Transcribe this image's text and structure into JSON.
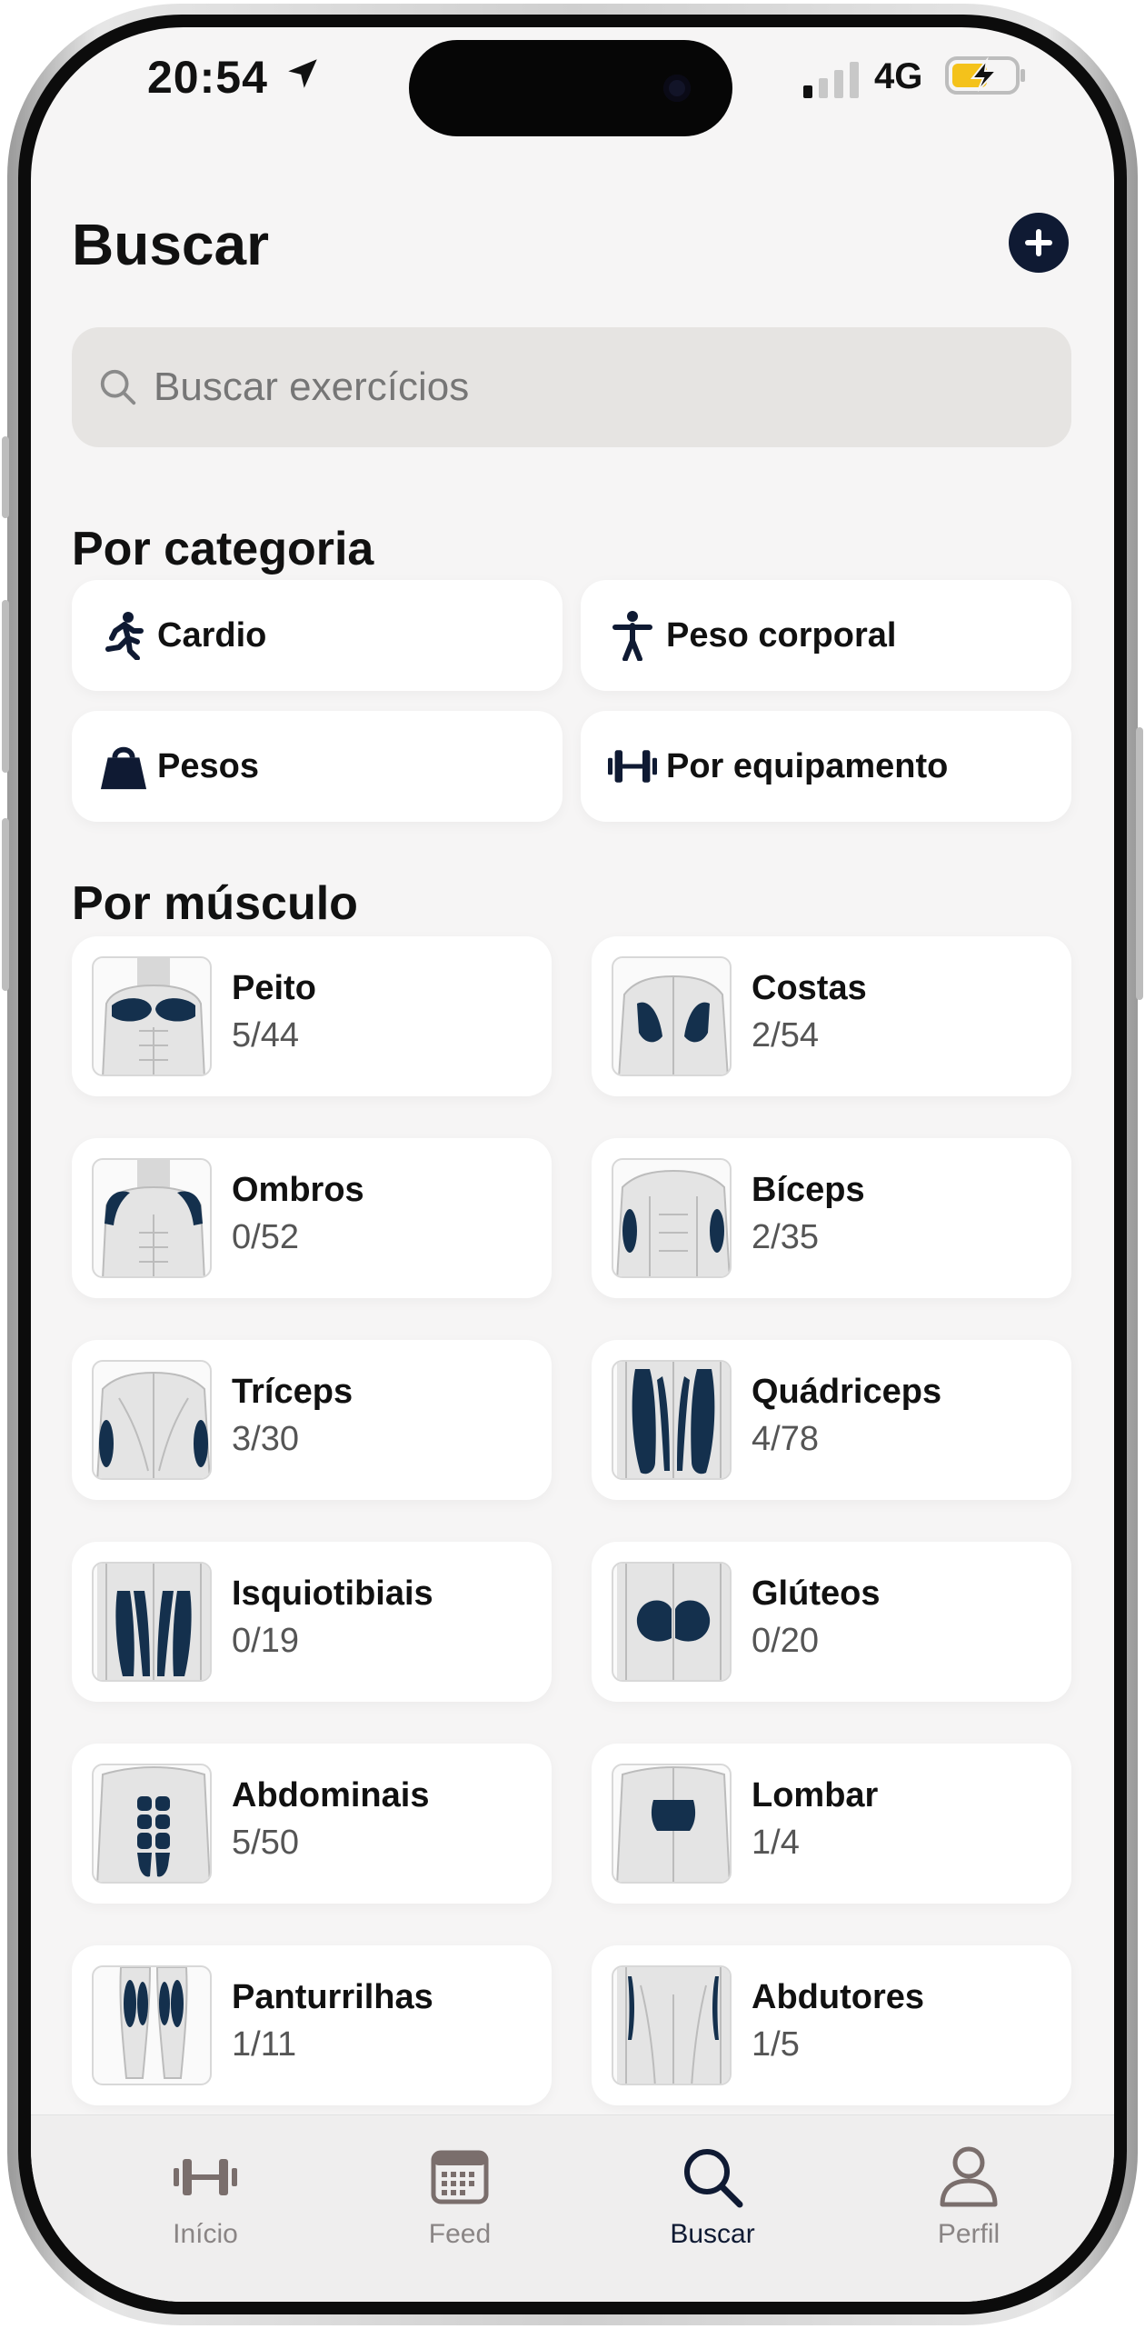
{
  "status_bar": {
    "time": "20:54",
    "network": "4G"
  },
  "header": {
    "title": "Buscar"
  },
  "search": {
    "placeholder": "Buscar exercícios"
  },
  "sections": {
    "category": "Por categoria",
    "muscle": "Por músculo"
  },
  "categories": [
    {
      "label": "Cardio",
      "icon": "running-person-icon"
    },
    {
      "label": "Peso corporal",
      "icon": "standing-person-icon"
    },
    {
      "label": "Pesos",
      "icon": "kettlebell-weight-icon"
    },
    {
      "label": "Por equipamento",
      "icon": "dumbbell-icon"
    }
  ],
  "muscles": [
    {
      "name": "Peito",
      "count": "5/44"
    },
    {
      "name": "Costas",
      "count": "2/54"
    },
    {
      "name": "Ombros",
      "count": "0/52"
    },
    {
      "name": "Bíceps",
      "count": "2/35"
    },
    {
      "name": "Tríceps",
      "count": "3/30"
    },
    {
      "name": "Quádriceps",
      "count": "4/78"
    },
    {
      "name": "Isquiotibiais",
      "count": "0/19"
    },
    {
      "name": "Glúteos",
      "count": "0/20"
    },
    {
      "name": "Abdominais",
      "count": "5/50"
    },
    {
      "name": "Lombar",
      "count": "1/4"
    },
    {
      "name": "Panturrilhas",
      "count": "1/11"
    },
    {
      "name": "Abdutores",
      "count": "1/5"
    }
  ],
  "tabs": [
    {
      "label": "Início",
      "icon": "dumbbell-icon"
    },
    {
      "label": "Feed",
      "icon": "calendar-icon"
    },
    {
      "label": "Buscar",
      "icon": "search-icon",
      "active": true
    },
    {
      "label": "Perfil",
      "icon": "person-icon"
    }
  ],
  "colors": {
    "accent": "#0f1a33",
    "muscle_highlight": "#14304d",
    "background": "#f6f5f5"
  }
}
